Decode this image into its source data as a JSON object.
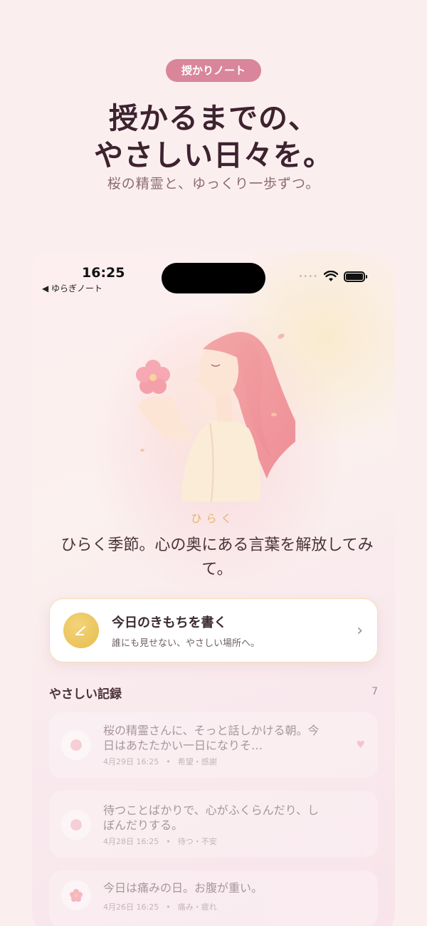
{
  "promo": {
    "badge": "授かりノート",
    "headline_line1": "授かるまでの、",
    "headline_line2": "やさしい日々を。",
    "subline": "桜の精霊と、ゆっくり一歩ずつ。"
  },
  "status_bar": {
    "time": "16:25",
    "back_app": "◀ ゆらぎノート",
    "signal_dots": "••••"
  },
  "spirit": {
    "name": "ひらく",
    "message": "ひらく季節。心の奥にある言葉を解放してみて。"
  },
  "write_card": {
    "title": "今日のきもちを書く",
    "subtitle": "誰にも見せない、やさしい場所へ。",
    "chevron": "›"
  },
  "records": {
    "title": "やさしい記録",
    "count": "7",
    "items": [
      {
        "text": "桜の精霊さんに、そっと話しかける朝。今日はあたたかい一日になりそ…",
        "date": "4月29日 16:25",
        "separator": "•",
        "tags": "希望・感謝",
        "heart": "♥"
      },
      {
        "text": "待つことばかりで、心がふくらんだり、しぼんだりする。",
        "date": "4月28日 16:25",
        "separator": "•",
        "tags": "待つ・不安"
      },
      {
        "text": "今日は痛みの日。お腹が重い。",
        "date": "4月26日 16:25",
        "separator": "•",
        "tags": "痛み・疲れ"
      }
    ]
  },
  "colors": {
    "badge": "#d9869a",
    "accent_gold": "#e6bd4e",
    "background": "#fbeeee"
  }
}
